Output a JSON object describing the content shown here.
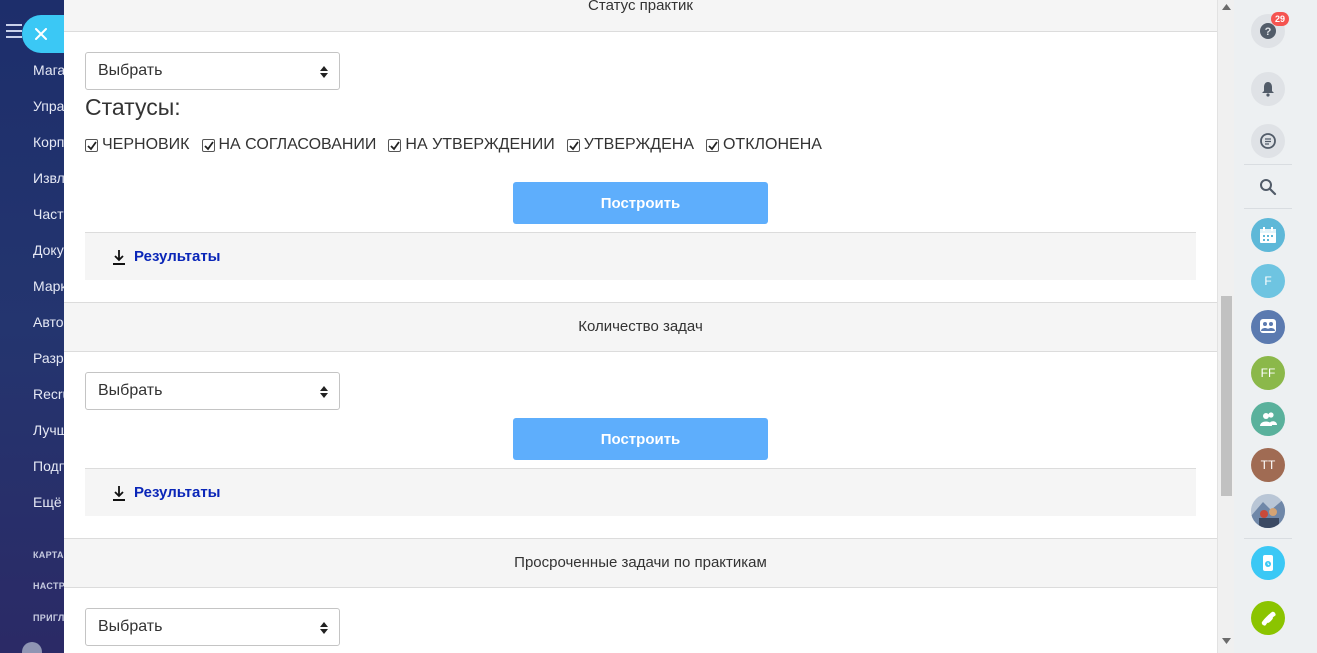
{
  "leftnav": {
    "items": [
      "Мага",
      "Упра",
      "Корп",
      "Извл",
      "Част",
      "Доку",
      "Марк",
      "Авто",
      "Разр",
      "Recru",
      "Лучш",
      "Подп",
      "Ещё"
    ],
    "small_items": [
      "КАРТА",
      "НАСТР",
      "ПРИГЛ"
    ]
  },
  "sections": [
    {
      "header": "Статус практик",
      "select_value": "Выбрать",
      "statuses_title": "Статусы:",
      "statuses": [
        {
          "label": "ЧЕРНОВИК",
          "checked": true
        },
        {
          "label": "НА СОГЛАСОВАНИИ",
          "checked": true
        },
        {
          "label": "НА УТВЕРЖДЕНИИ",
          "checked": true
        },
        {
          "label": "УТВЕРЖДЕНА",
          "checked": true
        },
        {
          "label": "ОТКЛОНЕНА",
          "checked": true
        }
      ],
      "build_label": "Построить",
      "results_label": "Результаты"
    },
    {
      "header": "Количество задач",
      "select_value": "Выбрать",
      "build_label": "Построить",
      "results_label": "Результаты"
    },
    {
      "header": "Просроченные задачи по практикам",
      "select_value": "Выбрать"
    }
  ],
  "rightbar": {
    "help_badge": "29",
    "avatars": {
      "f": "F",
      "ff": "FF",
      "tt": "TT"
    },
    "colors": {
      "calendar": "#5eb8d8",
      "f": "#6ec4e1",
      "group": "#5b7ab0",
      "ff": "#8bb84a",
      "users": "#5ab19c",
      "tt": "#a06b53",
      "phone_device": "#3bc8f5",
      "call": "#8bc400"
    }
  },
  "colors": {
    "accent_button": "#5eaefc",
    "close_button": "#3bc8f5",
    "results_link": "#0a26b8"
  }
}
